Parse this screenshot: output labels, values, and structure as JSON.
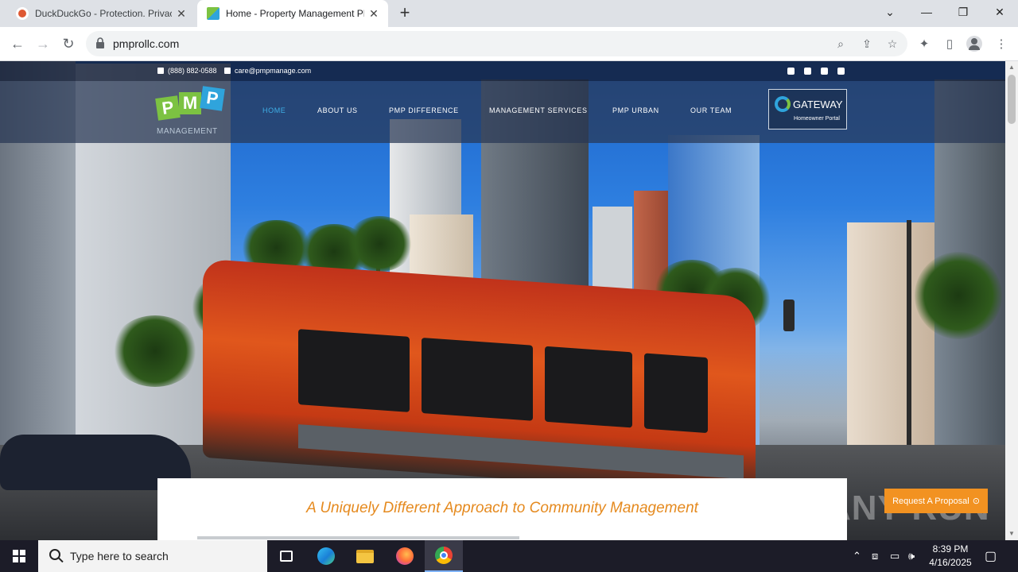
{
  "browser": {
    "tabs": [
      {
        "title": "DuckDuckGo - Protection. Privacy.",
        "active": false
      },
      {
        "title": "Home - Property Management PMP",
        "active": true
      }
    ],
    "new_tab_icon": "plus-icon",
    "url": "pmprollc.com"
  },
  "site": {
    "topbar": {
      "phone": "(888) 882-0588",
      "email": "care@pmpmanage.com",
      "social_icons": [
        "twitter-icon",
        "instagram-icon",
        "facebook-icon",
        "linkedin-icon"
      ]
    },
    "logo": {
      "letters": [
        "P",
        "M",
        "P"
      ],
      "word": "MANAGEMENT"
    },
    "nav": [
      "HOME",
      "ABOUT US",
      "PMP DIFFERENCE",
      "MANAGEMENT SERVICES",
      "PMP URBAN",
      "OUR TEAM"
    ],
    "gateway": {
      "name": "GATEWAY",
      "subtitle": "Homeowner Portal"
    },
    "tagline": "A Uniquely Different Approach to Community Management",
    "proposal_button": "Request A Proposal",
    "watermark": "ANY RUN"
  },
  "taskbar": {
    "search_placeholder": "Type here to search",
    "time": "8:39 PM",
    "date": "4/16/2025"
  },
  "colors": {
    "accent_orange": "#f29221",
    "tagline_orange": "#e58a1f",
    "nav_active": "#3fb0e8",
    "logo_green": "#7cc242",
    "logo_blue": "#2fa4dc"
  }
}
